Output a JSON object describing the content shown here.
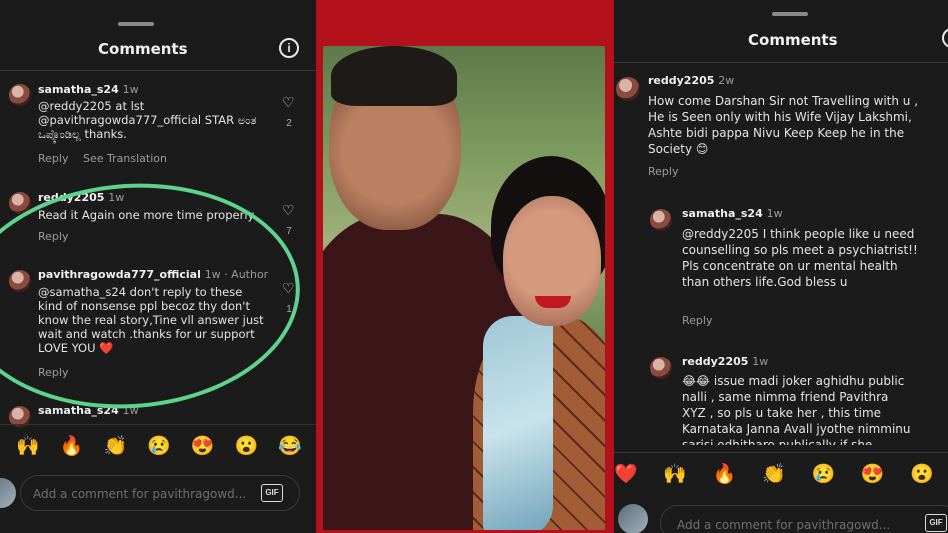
{
  "left_panel": {
    "title": "Comments",
    "comments": [
      {
        "user": "samatha_s24",
        "age": "1w",
        "mention": "@reddy2205",
        "text": "at lst @pavithragowda777_official  STAR ಅಂತ ಒಪ್ಕೊಂಡಿಲ್ಲ thanks.",
        "likes": "2",
        "reply": "Reply",
        "see_translation": "See Translation"
      },
      {
        "user": "reddy2205",
        "age": "1w",
        "text": "Read it Again one more time properly",
        "likes": "7",
        "reply": "Reply"
      },
      {
        "user": "pavithragowda777_official",
        "age": "1w · Author",
        "mention": "@samatha_s24",
        "text": "don't reply to these kind of nonsense ppl becoz thy don't know the real story,Tine vll answer just wait and watch .thanks for ur support LOVE YOU ❤️",
        "likes": "1",
        "reply": "Reply"
      },
      {
        "user": "samatha_s24",
        "age": "1w"
      }
    ],
    "emoji_bar": [
      "🙌",
      "🔥",
      "👏",
      "😢",
      "😍",
      "😮",
      "😂"
    ],
    "add_placeholder": "Add a comment for pavithragowd...",
    "gif_label": "GIF"
  },
  "right_panel": {
    "title": "Comments",
    "comments": [
      {
        "user": "reddy2205",
        "age": "2w",
        "text": "How come Darshan Sir not Travelling with u , He is Seen only with his Wife Vijay Lakshmi, Ashte bidi pappa Nivu Keep Keep he in the Society 😊",
        "reply": "Reply"
      },
      {
        "user": "samatha_s24",
        "age": "1w",
        "mention": "@reddy2205",
        "text": " I think people like u need counselling so pls meet a psychiatrist!! Pls concentrate  on ur mental health than others life.God bless u",
        "reply": "Reply"
      },
      {
        "user": "reddy2205",
        "age": "1w",
        "text": "😂😂 issue madi joker aghidhu public nalli , same nimma friend Pavithra XYZ , so pls u take her , this time Karnataka Janna Avall jyothe nimminu sarisi odhitharo publically  if she"
      }
    ],
    "emoji_bar": [
      "❤️",
      "🙌",
      "🔥",
      "👏",
      "😢",
      "😍",
      "😮"
    ],
    "add_placeholder": "Add a comment for pavithragowd...",
    "gif_label": "GIF"
  },
  "colors": {
    "background_red": "#b3121c",
    "panel_dark": "#1b1b1b",
    "highlight_circle": "#5ed38b"
  }
}
